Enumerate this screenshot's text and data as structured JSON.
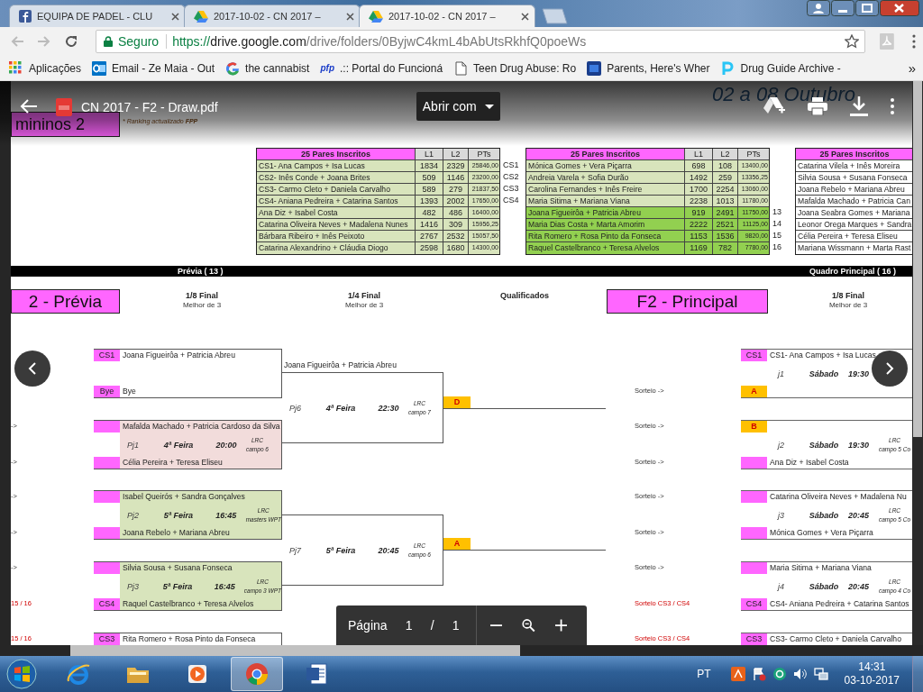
{
  "browser": {
    "tabs": [
      {
        "title": "EQUIPA DE PADEL - CLU",
        "kind": "facebook",
        "selected": false
      },
      {
        "title": "2017-10-02 - CN 2017 –",
        "kind": "drive",
        "selected": false
      },
      {
        "title": "2017-10-02 - CN 2017 –",
        "kind": "drive",
        "selected": true
      }
    ],
    "address": {
      "secure_label": "Seguro",
      "scheme": "https://",
      "host": "drive.google.com",
      "path": "/drive/folders/0ByjwC4kmL4bAbUtsRkhfQ0poeWs"
    },
    "bookmarks": [
      {
        "label": "Aplicações",
        "kind": "apps"
      },
      {
        "label": "Email - Ze Maia - Out",
        "kind": "outlook"
      },
      {
        "label": "the cannabist",
        "kind": "google"
      },
      {
        "label": ".:: Portal do Funcioná",
        "kind": "text",
        "icon_text": "pfp"
      },
      {
        "label": "Teen Drug Abuse: Ro",
        "kind": "page"
      },
      {
        "label": "Parents, Here's Wher",
        "kind": "bookmark"
      },
      {
        "label": "Drug Guide Archive -",
        "kind": "letter"
      }
    ],
    "bookmarks_more": "»"
  },
  "pdf_viewer": {
    "file_name": "CN 2017 - F2 - Draw.pdf",
    "open_with": "Abrir com",
    "page_label": "Página",
    "page_current": "1",
    "page_separator": "/",
    "page_total": "1"
  },
  "document": {
    "header": {
      "fragment": "mininos 2",
      "ranking_note": "* Ranking actualizado **FPP**",
      "dates": "02 a 08 Outubro"
    },
    "tables": [
      {
        "columns": [
          "25 Pares Inscritos",
          "L1",
          "L2",
          "PTs"
        ],
        "rows": [
          {
            "cells": [
              "CS1- Ana Campos + Isa Lucas",
              "1834",
              "2329",
              "25846,00"
            ],
            "tag": "CS1",
            "color": "#d8e4bc"
          },
          {
            "cells": [
              "CS2- Inês Conde + Joana Brites",
              "509",
              "1146",
              "23200,00"
            ],
            "tag": "CS2",
            "color": "#d8e4bc"
          },
          {
            "cells": [
              "CS3- Carmo Cleto + Daniela Carvalho",
              "589",
              "279",
              "21837,50"
            ],
            "tag": "CS3",
            "color": "#d8e4bc"
          },
          {
            "cells": [
              "CS4- Aniana Pedreira + Catarina Santos",
              "1393",
              "2002",
              "17650,00"
            ],
            "tag": "CS4",
            "color": "#d8e4bc"
          },
          {
            "cells": [
              "Ana Diz + Isabel Costa",
              "482",
              "486",
              "16400,00"
            ],
            "color": "#d8e4bc"
          },
          {
            "cells": [
              "Catarina Oliveira Neves + Madalena Nunes",
              "1416",
              "309",
              "15956,25"
            ],
            "color": "#d8e4bc"
          },
          {
            "cells": [
              "Bárbara Ribeiro + Inês Peixoto",
              "2767",
              "2532",
              "15057,50"
            ],
            "color": "#d8e4bc"
          },
          {
            "cells": [
              "Catarina Alexandrino + Cláudia Diogo",
              "2598",
              "1680",
              "14300,00"
            ],
            "color": "#d8e4bc"
          }
        ]
      },
      {
        "columns": [
          "25 Pares Inscritos",
          "L1",
          "L2",
          "PTs"
        ],
        "rows": [
          {
            "cells": [
              "Mónica Gomes + Vera Piçarra",
              "698",
              "108",
              "13400,00"
            ],
            "color": "#d8e4bc"
          },
          {
            "cells": [
              "Andreia Varela + Sofia Durão",
              "1492",
              "259",
              "13356,25"
            ],
            "color": "#d8e4bc"
          },
          {
            "cells": [
              "Carolina Fernandes + Inês Freire",
              "1700",
              "2254",
              "13060,00"
            ],
            "color": "#d8e4bc"
          },
          {
            "cells": [
              "Maria Sitima + Mariana Viana",
              "2238",
              "1013",
              "11780,00"
            ],
            "color": "#d8e4bc"
          },
          {
            "cells": [
              "Joana Figueirôa + Patricia Abreu",
              "919",
              "2491",
              "11750,00"
            ],
            "tag": "13",
            "color": "#92d050"
          },
          {
            "cells": [
              "Maria Dias Costa + Marta Amorim",
              "2222",
              "2521",
              "11125,00"
            ],
            "tag": "14",
            "color": "#92d050"
          },
          {
            "cells": [
              "Rita Romero + Rosa Pinto da Fonseca",
              "1153",
              "1536",
              "9820,00"
            ],
            "tag": "15",
            "color": "#92d050"
          },
          {
            "cells": [
              "Raquel Castelbranco + Teresa Alvelos",
              "1169",
              "782",
              "7780,00"
            ],
            "tag": "16",
            "color": "#92d050"
          }
        ]
      },
      {
        "columns": [
          "25 Pares Inscritos"
        ],
        "rows": [
          {
            "cells": [
              "Catarina Vilela + Inês Moreira"
            ],
            "color": "#ffffff"
          },
          {
            "cells": [
              "Silvia Sousa + Susana Fonseca"
            ],
            "color": "#ffffff"
          },
          {
            "cells": [
              "Joana Rebelo + Mariana Abreu"
            ],
            "color": "#ffffff"
          },
          {
            "cells": [
              "Mafalda Machado + Patricia Can"
            ],
            "color": "#ffffff"
          },
          {
            "cells": [
              "Joana Seabra Gomes + Mariana"
            ],
            "color": "#ffffff"
          },
          {
            "cells": [
              "Leonor Orega Marques + Sandra"
            ],
            "color": "#ffffff"
          },
          {
            "cells": [
              "Célia Pereira + Teresa Eliseu"
            ],
            "color": "#ffffff"
          },
          {
            "cells": [
              "Mariana Wissmann + Marta Rast"
            ],
            "color": "#ffffff"
          }
        ]
      }
    ],
    "bars": [
      "Prévia ( 13 )",
      "Quadro Principal ( 16 )"
    ],
    "headings": [
      {
        "kind": "banner",
        "title": "2 - Prévia"
      },
      {
        "kind": "round",
        "title": "1/8 Final",
        "subtitle": "Melhor de 3"
      },
      {
        "kind": "round",
        "title": "1/4 Final",
        "subtitle": "Melhor de 3"
      },
      {
        "kind": "label",
        "title": "Qualificados"
      },
      {
        "kind": "banner",
        "title": "F2 - Principal"
      },
      {
        "kind": "round",
        "title": "1/8 Final",
        "subtitle": "Melhor de 3"
      }
    ],
    "previa_matches": [
      {
        "color": "#ffffff",
        "entries": [
          {
            "kind": "seed",
            "seed": "CS1",
            "name": "Joana Figueirôa + Patricia Abreu"
          },
          {
            "kind": "seed",
            "seed": "Bye",
            "name": "Bye"
          }
        ]
      },
      {
        "color": "#f2dcdb",
        "info": {
          "game": "Pj1",
          "day": "4ª Feira",
          "time": "20:00",
          "venue": "LRC",
          "court": "campo 6"
        },
        "entries": [
          {
            "kind": "seed",
            "name": "Mafalda Machado + Patricia Cardoso da Silva",
            "note": "->",
            "alert": false
          },
          {
            "kind": "seed",
            "name": "Célia Pereira + Teresa Eliseu",
            "note": "->",
            "alert": false
          }
        ]
      },
      {
        "color": "#d8e4bc",
        "info": {
          "game": "Pj2",
          "day": "5ª Feira",
          "time": "16:45",
          "venue": "LRC",
          "court": "masters WPT"
        },
        "entries": [
          {
            "kind": "seed",
            "name": "Isabel Queirós + Sandra Gonçalves",
            "note": "->",
            "alert": false
          },
          {
            "kind": "seed",
            "name": "Joana Rebelo + Mariana Abreu",
            "note": "->",
            "alert": false
          }
        ]
      },
      {
        "color": "#d8e4bc",
        "info": {
          "game": "Pj3",
          "day": "5ª Feira",
          "time": "16:45",
          "venue": "LRC",
          "court": "campo 3 WPT"
        },
        "entries": [
          {
            "kind": "seed",
            "name": "Silvia Sousa + Susana Fonseca",
            "note": "->",
            "alert": false
          },
          {
            "kind": "seed",
            "seed": "CS4",
            "name": "Raquel Castelbranco + Teresa Alvelos",
            "note": "15 / 16",
            "alert": true
          }
        ]
      },
      {
        "color": "#ffffff",
        "entries": [
          {
            "kind": "seed",
            "seed": "CS3",
            "name": "Rita Romero + Rosa Pinto da Fonseca",
            "note": "15 / 16",
            "alert": true
          }
        ]
      }
    ],
    "quarter_matches": [
      {
        "winner": "Joana Figueirôa + Patricia Abreu",
        "info": {
          "game": "Pj6",
          "day": "4ª Feira",
          "time": "22:30",
          "venue": "LRC",
          "court": "campo 7"
        },
        "slot": "D"
      },
      {
        "info": {
          "game": "Pj7",
          "day": "5ª Feira",
          "time": "20:45",
          "venue": "LRC",
          "court": "campo 6"
        },
        "slot": "A"
      }
    ],
    "main_matches": [
      {
        "info": {
          "game": "j1",
          "day": "Sábado",
          "time": "19:30"
        },
        "entries": [
          {
            "kind": "seed",
            "seed": "CS1",
            "name": "CS1- Ana Campos + Isa Lucas"
          },
          {
            "kind": "slot",
            "seed": "A",
            "note": "Sorteio ->",
            "alert": false
          }
        ]
      },
      {
        "info": {
          "game": "j2",
          "day": "Sábado",
          "time": "19:30",
          "venue": "LRC",
          "court": "campo 5 Co"
        },
        "entries": [
          {
            "kind": "slot",
            "seed": "B",
            "note": "Sorteio ->",
            "alert": false
          },
          {
            "kind": "seed",
            "name": "Ana Diz + Isabel Costa",
            "note": "Sorteio ->",
            "alert": false
          }
        ]
      },
      {
        "info": {
          "game": "j3",
          "day": "Sábado",
          "time": "20:45",
          "venue": "LRC",
          "court": "campo 5 Co"
        },
        "entries": [
          {
            "kind": "seed",
            "name": "Catarina Oliveira Neves + Madalena Nu",
            "note": "Sorteio ->",
            "alert": false
          },
          {
            "kind": "seed",
            "name": "Mónica Gomes + Vera Piçarra",
            "note": "Sorteio ->",
            "alert": false
          }
        ]
      },
      {
        "info": {
          "game": "j4",
          "day": "Sábado",
          "time": "20:45",
          "venue": "LRC",
          "court": "campo 4 Co"
        },
        "entries": [
          {
            "kind": "seed",
            "name": "Maria Sitima + Mariana Viana",
            "note": "Sorteio ->",
            "alert": false
          },
          {
            "kind": "seed",
            "seed": "CS4",
            "name": "CS4- Aniana Pedreira + Catarina Santos",
            "note": "Sorteio CS3 / CS4",
            "alert": true
          }
        ]
      },
      {
        "entries": [
          {
            "kind": "seed",
            "seed": "CS3",
            "name": "CS3- Carmo Cleto + Daniela Carvalho",
            "note": "Sorteio CS3 / CS4",
            "alert": true
          }
        ]
      }
    ]
  },
  "taskbar": {
    "apps": [
      {
        "kind": "ie",
        "selected": false
      },
      {
        "kind": "explorer",
        "selected": false
      },
      {
        "kind": "media",
        "selected": false
      },
      {
        "kind": "chrome",
        "selected": true
      },
      {
        "kind": "word",
        "selected": false
      }
    ],
    "language": "PT",
    "time": "14:31",
    "date": "03-10-2017"
  }
}
